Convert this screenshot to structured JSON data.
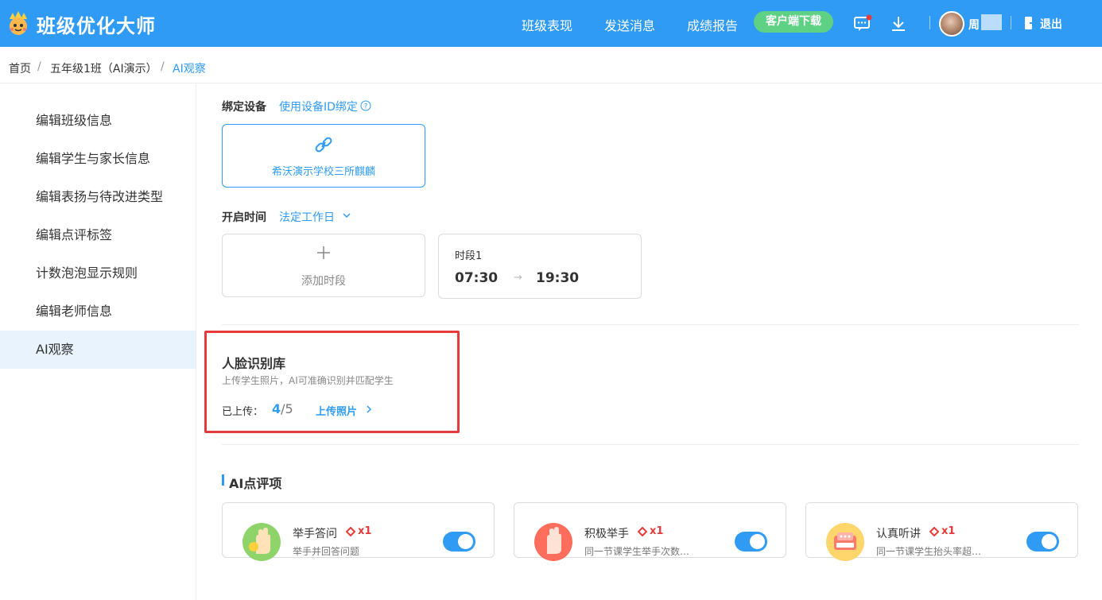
{
  "header": {
    "brand": "班级优化大师",
    "nav": [
      "班级表现",
      "发送消息",
      "成绩报告"
    ],
    "download_button": "客户端下载",
    "user_initial": "周",
    "logout": "退出",
    "colors": {
      "primary": "#2f9bf5",
      "download_button": "#5fd184",
      "notice_dot": "#e53b3b"
    }
  },
  "breadcrumb": {
    "items": [
      "首页",
      "五年级1班（AI演示）",
      "AI观察"
    ],
    "separator": "/"
  },
  "sidebar": {
    "items": [
      {
        "label": "编辑班级信息"
      },
      {
        "label": "编辑学生与家长信息"
      },
      {
        "label": "编辑表扬与待改进类型"
      },
      {
        "label": "编辑点评标签"
      },
      {
        "label": "计数泡泡显示规则"
      },
      {
        "label": "编辑老师信息"
      },
      {
        "label": "AI观察",
        "active": true
      }
    ]
  },
  "device": {
    "label": "绑定设备",
    "bind_link": "使用设备ID绑定",
    "card_name": "希沃演示学校三所麒麟"
  },
  "schedule": {
    "label": "开启时间",
    "mode": "法定工作日",
    "add_slot": "添加时段",
    "slots": [
      {
        "title": "时段1",
        "start": "07:30",
        "end": "19:30"
      }
    ]
  },
  "face_library": {
    "title": "人脸识别库",
    "desc": "上传学生照片，AI可准确识别并匹配学生",
    "uploaded_label": "已上传：",
    "uploaded_count": "4",
    "total": "/5",
    "upload_link": "上传照片"
  },
  "ai_items": {
    "title": "AI点评项",
    "cards": [
      {
        "name": "举手答问",
        "points": "x1",
        "desc": "举手并回答问题",
        "enabled": true,
        "icon": "raise-hand-answer-icon"
      },
      {
        "name": "积极举手",
        "points": "x1",
        "desc": "同一节课学生举手次数…",
        "enabled": true,
        "icon": "raise-hand-icon"
      },
      {
        "name": "认真听讲",
        "points": "x1",
        "desc": "同一节课学生抬头率超…",
        "enabled": true,
        "icon": "listen-board-icon"
      }
    ]
  }
}
